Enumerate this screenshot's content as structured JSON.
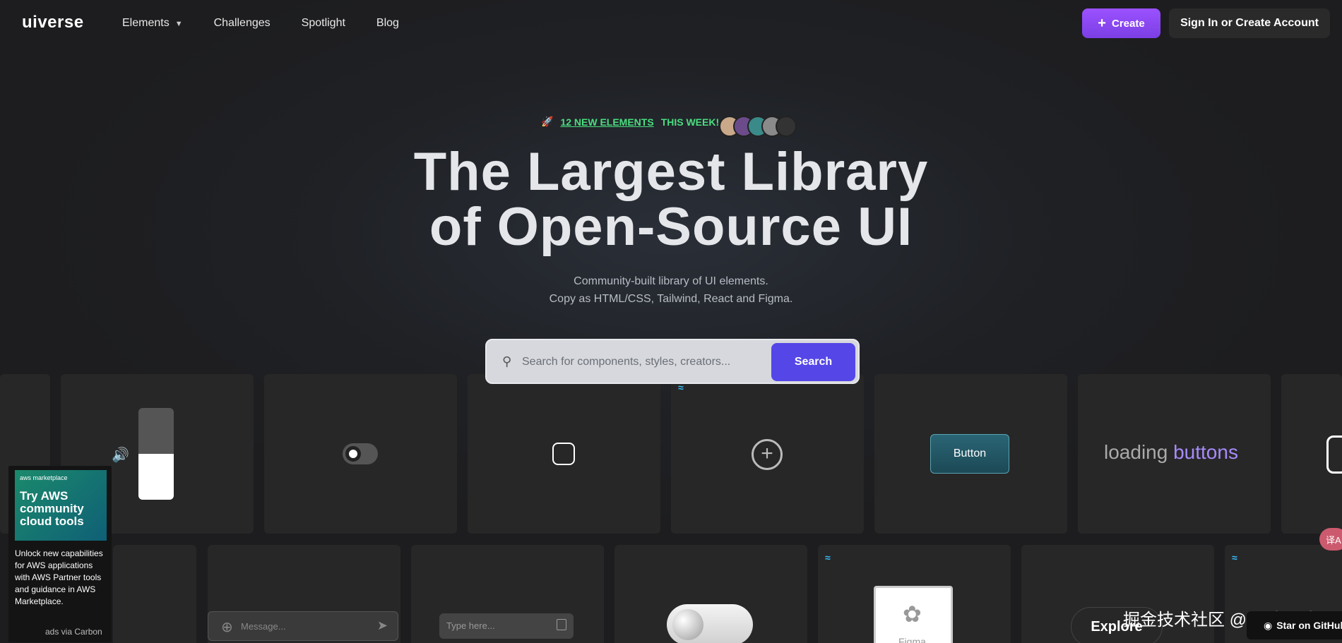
{
  "header": {
    "logo": "uiverse",
    "nav": [
      "Elements",
      "Challenges",
      "Spotlight",
      "Blog"
    ],
    "create": "Create",
    "signin": "Sign In or Create Account"
  },
  "hero": {
    "badge_link": "12 NEW ELEMENTS",
    "badge_rest": "THIS WEEK!",
    "title_1": "The Largest Library",
    "title_2": "of Open-Source UI",
    "sub_1": "Community-built library of UI elements.",
    "sub_2": "Copy as HTML/CSS, Tailwind, React and Figma."
  },
  "search": {
    "placeholder": "Search for components, styles, creators...",
    "button": "Search"
  },
  "cards": {
    "button_demo": "Button",
    "loading": "loading",
    "loading_hl": "buttons",
    "message_placeholder": "Message...",
    "type_placeholder": "Type here...",
    "figma_label": "Figma",
    "explore": "Explore",
    "github": "Star on GitHub",
    "volume_level_percent": 50
  },
  "ad": {
    "brand": "aws marketplace",
    "headline": "Try AWS community cloud tools",
    "body": "Unlock new capabilities for AWS applications with AWS Partner tools and guidance in AWS Marketplace.",
    "via": "ads via Carbon"
  },
  "overlay": {
    "watermark": "掘金技术社区 @ 一点一木",
    "translate": "译A"
  },
  "colors": {
    "accent": "#7b3fe4",
    "search_button": "#5546e8",
    "badge_green": "#4ade80"
  }
}
